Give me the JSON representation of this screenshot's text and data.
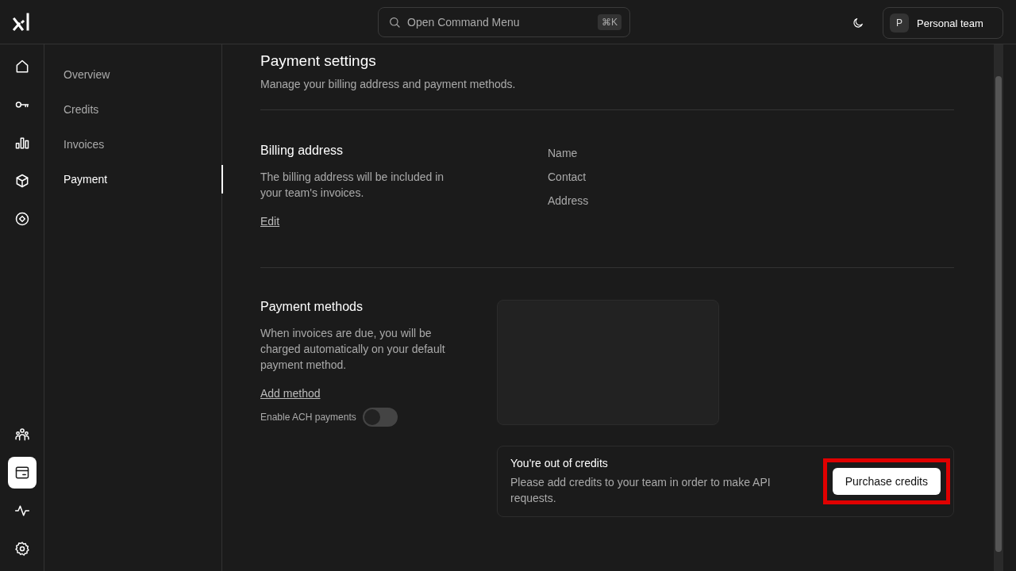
{
  "header": {
    "search": {
      "placeholder": "Open Command Menu",
      "shortcut": "⌘K"
    },
    "team": {
      "initial": "P",
      "name": "Personal team"
    }
  },
  "rail": {
    "top_items": [
      {
        "kind": "home",
        "selected": false
      },
      {
        "kind": "key",
        "selected": false
      },
      {
        "kind": "chart",
        "selected": false
      },
      {
        "kind": "cube",
        "selected": false
      },
      {
        "kind": "target",
        "selected": false
      }
    ],
    "bottom_items": [
      {
        "kind": "people",
        "selected": false
      },
      {
        "kind": "billing",
        "selected": true
      },
      {
        "kind": "activity",
        "selected": false
      },
      {
        "kind": "settings",
        "selected": false
      }
    ]
  },
  "subnav": [
    {
      "label": "Overview",
      "selected": false
    },
    {
      "label": "Credits",
      "selected": false
    },
    {
      "label": "Invoices",
      "selected": false
    },
    {
      "label": "Payment",
      "selected": true
    }
  ],
  "page": {
    "title": "Payment settings",
    "subtitle": "Manage your billing address and payment methods.",
    "billing": {
      "title": "Billing address",
      "text": "The billing address will be included in your team's invoices.",
      "edit_link": "Edit",
      "fields": [
        "Name",
        "Contact",
        "Address"
      ]
    },
    "payment": {
      "title": "Payment methods",
      "text": "When invoices are due, you will be charged automatically on your default payment method.",
      "add_link": "Add method",
      "ach": {
        "label": "Enable ACH payments",
        "on": false
      }
    },
    "credits": {
      "title": "You're out of credits",
      "text": "Please add credits to your team in order to make API requests.",
      "button": {
        "label": "Purchase credits",
        "highlighted": true
      }
    }
  }
}
